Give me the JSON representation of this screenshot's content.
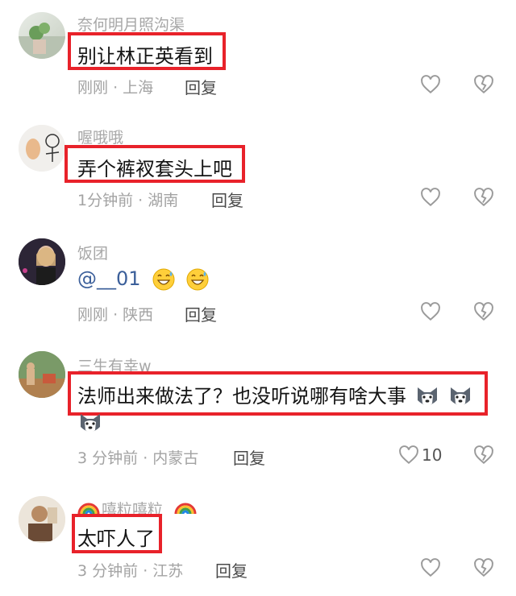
{
  "comments": [
    {
      "username": "奈何明月照沟渠",
      "text": "别让林正英看到",
      "time": "刚刚",
      "location": "上海",
      "reply": "回复",
      "likes": ""
    },
    {
      "username": "喔哦哦",
      "text": "弄个裤衩套头上吧",
      "time": "1分钟前",
      "location": "湖南",
      "reply": "回复",
      "likes": ""
    },
    {
      "username": "饭团",
      "mention": "@__01",
      "time": "刚刚",
      "location": "陕西",
      "reply": "回复",
      "likes": ""
    },
    {
      "username": "三生有幸w",
      "text": "法师出来做法了？也没听说哪有啥大事",
      "time": "3 分钟前",
      "location": "内蒙古",
      "reply": "回复",
      "likes": "10"
    },
    {
      "username": "嘻粒嘻粒",
      "text": "太吓人了",
      "time": "3 分钟前",
      "location": "江苏",
      "reply": "回复",
      "likes": ""
    }
  ],
  "separator": "·",
  "icons": {
    "like": "heart-outline-icon",
    "dislike": "broken-heart-icon",
    "grin_emoji": "grinning-sweat-emoji",
    "husky_emoji": "husky-dog-emoji",
    "rainbow_emoji": "rainbow-emoji"
  },
  "colors": {
    "highlight_box": "#e8222a",
    "secondary_text": "#a3a3a3",
    "mention": "#3b5f9a"
  }
}
